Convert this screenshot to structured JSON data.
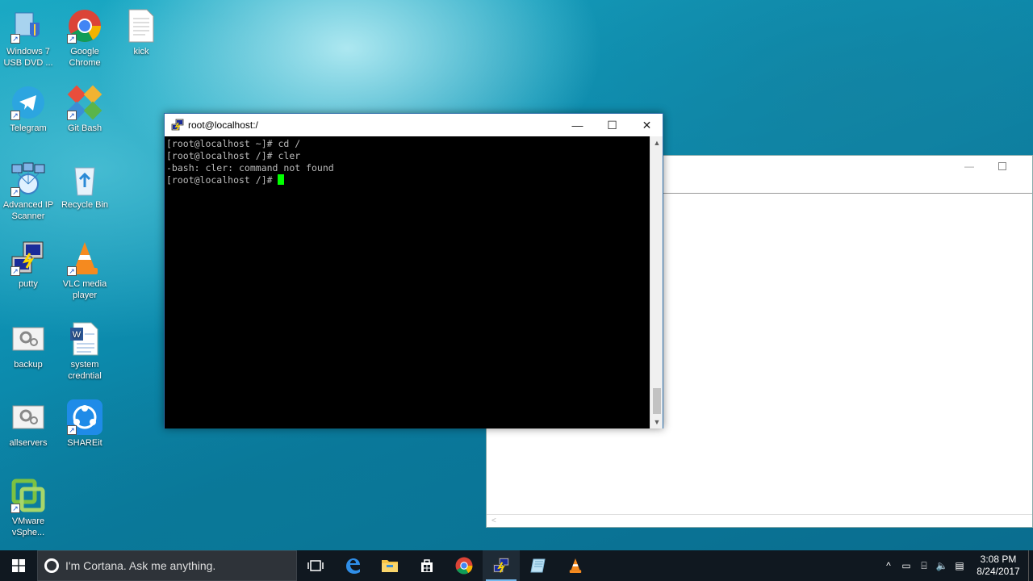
{
  "desktop": {
    "icons": [
      {
        "label": "Windows 7 USB DVD ...",
        "icon": "usb-dvd-tool-icon"
      },
      {
        "label": "Google Chrome",
        "icon": "chrome-icon"
      },
      {
        "label": "kick",
        "icon": "text-file-icon"
      },
      {
        "label": "Telegram",
        "icon": "telegram-icon"
      },
      {
        "label": "Git Bash",
        "icon": "git-bash-icon"
      },
      {
        "label": "Advanced IP Scanner",
        "icon": "ip-scanner-icon"
      },
      {
        "label": "Recycle Bin",
        "icon": "recycle-bin-icon"
      },
      {
        "label": "putty",
        "icon": "putty-icon"
      },
      {
        "label": "VLC media player",
        "icon": "vlc-icon"
      },
      {
        "label": "backup",
        "icon": "settings-file-icon"
      },
      {
        "label": "system credntial",
        "icon": "word-document-icon"
      },
      {
        "label": "allservers",
        "icon": "settings-file-icon"
      },
      {
        "label": "SHAREit",
        "icon": "shareit-icon"
      },
      {
        "label": "VMware vSphe...",
        "icon": "vmware-vsphere-icon"
      }
    ]
  },
  "putty_window": {
    "title": "root@localhost:/",
    "controls": {
      "minimize": "—",
      "maximize": "☐",
      "close": "✕"
    },
    "terminal_lines": [
      "[root@localhost ~]# cd /",
      "[root@localhost /]# cler",
      "-bash: cler: command not found",
      "[root@localhost /]# "
    ],
    "cursor_color": "#00ff00"
  },
  "background_window": {
    "controls": {
      "minimize": "—"
    },
    "hscroll_arrow": "<"
  },
  "taskbar": {
    "search_placeholder": "I'm Cortana. Ask me anything.",
    "apps": [
      "task-view",
      "edge",
      "file-explorer",
      "store",
      "chrome",
      "putty",
      "notepad-or-paper",
      "vlc"
    ],
    "tray": {
      "chevron": "^",
      "time": "3:08 PM",
      "date": "8/24/2017"
    }
  },
  "colors": {
    "terminal_bg": "#000000",
    "terminal_fg": "#bbbbbb",
    "taskbar_bg": "#101820"
  }
}
